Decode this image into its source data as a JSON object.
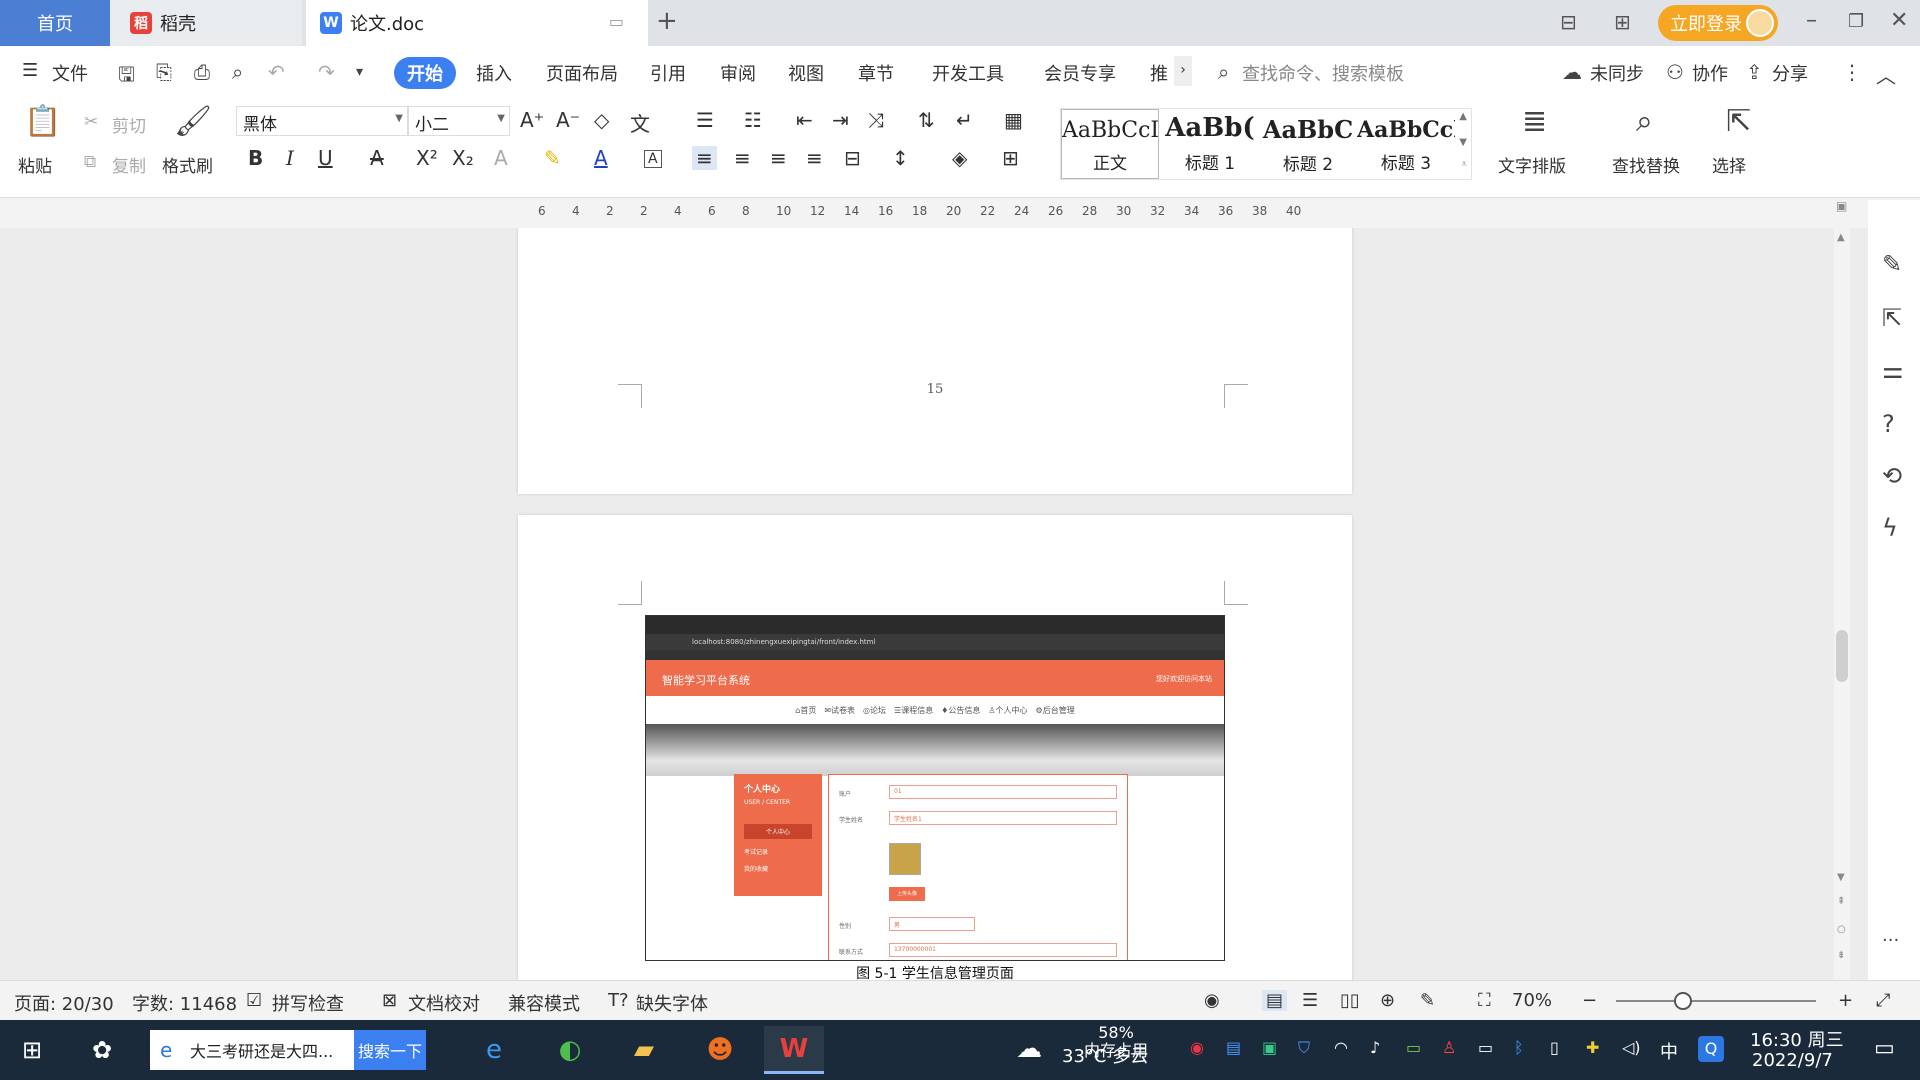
{
  "tabs": {
    "home": "首页",
    "daoke": "稻壳",
    "doc": "论文.doc",
    "add": "+"
  },
  "account": {
    "login": "立即登录"
  },
  "menu": {
    "file": "文件",
    "items": [
      "开始",
      "插入",
      "页面布局",
      "引用",
      "审阅",
      "视图",
      "章节",
      "开发工具",
      "会员专享",
      "推"
    ],
    "search_placeholder": "查找命令、搜索模板",
    "sync": "未同步",
    "collab": "协作",
    "share": "分享"
  },
  "ribbon": {
    "paste": "粘贴",
    "cut": "剪切",
    "copy": "复制",
    "format_painter": "格式刷",
    "font_name": "黑体",
    "font_size": "小二",
    "styles": [
      {
        "sample": "AaBbCcI",
        "name": "正文"
      },
      {
        "sample": "AaBb(",
        "name": "标题 1"
      },
      {
        "sample": "AaBbC",
        "name": "标题 2"
      },
      {
        "sample": "AaBbCcl",
        "name": "标题 3"
      }
    ],
    "text_layout": "文字排版",
    "find_replace": "查找替换",
    "select": "选择"
  },
  "ruler": {
    "ticks": [
      "6",
      "4",
      "2",
      "2",
      "4",
      "6",
      "8",
      "10",
      "12",
      "14",
      "16",
      "18",
      "20",
      "22",
      "24",
      "26",
      "28",
      "30",
      "32",
      "34",
      "36",
      "38",
      "40"
    ]
  },
  "document": {
    "page_number": "15",
    "caption": "图 5-1 学生信息管理页面",
    "embedded": {
      "url": "localhost:8080/zhinengxuexipingtai/front/index.html",
      "site_title": "智能学习平台系统",
      "header_right": "您好欢迎访问本站",
      "nav": "⌂首页　✉试卷表　◎论坛　☰课程信息　♦公告信息　♙个人中心　⚙后台管理",
      "sidebar_title": "个人中心",
      "sidebar_sub": "USER / CENTER",
      "sidebar_active": "个人中心",
      "sidebar_items": [
        "考试记录",
        "我的收藏"
      ],
      "fields": [
        {
          "label": "账户",
          "value": "01"
        },
        {
          "label": "学生姓名",
          "value": "学生姓名1"
        },
        {
          "label": "性别",
          "value": "男"
        },
        {
          "label": "联系方式",
          "value": "13700000001"
        }
      ],
      "upload": "上传头像"
    }
  },
  "status": {
    "page": "页面: 20/30",
    "words": "字数: 11468",
    "spell": "拼写检查",
    "proof": "文档校对",
    "compat": "兼容模式",
    "missing_font": "缺失字体",
    "zoom": "70%"
  },
  "taskbar": {
    "search_text": "大三考研还是大四...",
    "search_btn": "搜索一下",
    "weather": "33°C 多云",
    "memory": "58%\n内存占用",
    "ime": "中",
    "time": "16:30 周三",
    "date": "2022/9/7"
  }
}
